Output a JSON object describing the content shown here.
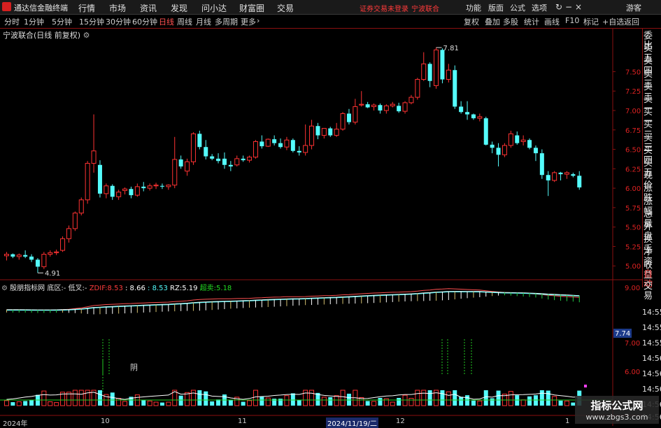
{
  "titlebar": {
    "app_name": "通达信金融终端",
    "menu": [
      "行情",
      "市场",
      "资讯",
      "发现",
      "问小达",
      "财富圈",
      "交易"
    ],
    "notice": "证券交易未登录",
    "stock_name": "宁波联合",
    "right_menu": [
      "功能",
      "版面",
      "公式",
      "选项"
    ],
    "user": "游客"
  },
  "period_bar": {
    "periods": [
      "分时",
      "1分钟",
      "5分钟",
      "15分钟",
      "30分钟",
      "60分钟",
      "日线",
      "周线",
      "月线",
      "多周期",
      "更多"
    ],
    "active": "日线",
    "tools": [
      "复权",
      "叠加",
      "多股",
      "统计",
      "画线",
      "F10",
      "标记",
      "+自选",
      "返回"
    ]
  },
  "price_panel": {
    "title": "宁波联合(日线 前复权)",
    "high_label": "7.81",
    "low_label": "4.91"
  },
  "side_panel": {
    "items": [
      "委比",
      "卖五",
      "卖四",
      "卖三",
      "卖二",
      "卖一",
      "买一",
      "买二",
      "买三",
      "买四",
      "买五",
      "现价",
      "涨跌",
      "涨幅",
      "总量",
      "外盘",
      "换手",
      "净资",
      "收益"
    ],
    "tabs": [
      "自动",
      "交易"
    ]
  },
  "indicator": {
    "name": "殷朋指标网",
    "zone_label": "底区:",
    "zone_value": "-",
    "low_label": "低叉:",
    "low_value": "-",
    "zdif_label": "ZDIF:",
    "zdif_value": "8.53",
    "v2": ": 8.66",
    "v3": ": 8.53",
    "rz_label": "RZ:",
    "rz_value": "5.19",
    "super_label": "超卖:",
    "super_value": "5.18",
    "current_tag": "7.74",
    "annotation": "阴"
  },
  "times": [
    "14:55",
    "14:55",
    "14:55",
    "14:56",
    "14:56",
    "14:56",
    "14:56",
    "14:56"
  ],
  "dates": [
    "2024年",
    "10",
    "11",
    "2024/11/19/二",
    "12",
    "1"
  ],
  "watermark": {
    "title": "指标公式网",
    "url": "www.zbgs3.com"
  },
  "colors": {
    "up": "#ff3232",
    "down": "#54fcfc",
    "grid": "#8a1010",
    "ma": "#ffffff"
  },
  "chart_data": {
    "type": "candlestick",
    "price_axis_ticks": [
      "7.50",
      "7.25",
      "7.00",
      "6.75",
      "6.50",
      "6.25",
      "6.00",
      "5.75",
      "5.50",
      "5.25",
      "5.00"
    ],
    "price_range": [
      4.84,
      7.9
    ],
    "indicator_axis_ticks": [
      "9.00",
      "7.00",
      "6.00"
    ],
    "candles": [
      [
        5.13,
        5.18,
        5.07,
        5.15
      ],
      [
        5.15,
        5.16,
        5.1,
        5.12
      ],
      [
        5.12,
        5.16,
        5.08,
        5.14
      ],
      [
        5.14,
        5.2,
        5.1,
        5.12
      ],
      [
        5.12,
        5.15,
        5.05,
        5.08
      ],
      [
        5.08,
        5.1,
        4.91,
        4.99
      ],
      [
        4.99,
        5.18,
        4.96,
        5.15
      ],
      [
        5.15,
        5.2,
        5.12,
        5.17
      ],
      [
        5.17,
        5.21,
        5.14,
        5.18
      ],
      [
        5.2,
        5.38,
        5.18,
        5.35
      ],
      [
        5.35,
        5.52,
        5.3,
        5.48
      ],
      [
        5.48,
        5.7,
        5.45,
        5.68
      ],
      [
        5.68,
        5.88,
        5.65,
        5.85
      ],
      [
        5.85,
        6.35,
        5.8,
        6.32
      ],
      [
        6.32,
        6.95,
        6.2,
        6.48
      ],
      [
        6.3,
        6.36,
        5.88,
        5.93
      ],
      [
        5.93,
        6.06,
        5.87,
        6.03
      ],
      [
        6.03,
        6.05,
        5.85,
        5.89
      ],
      [
        5.89,
        5.98,
        5.85,
        5.95
      ],
      [
        5.97,
        6.01,
        5.92,
        5.99
      ],
      [
        5.99,
        6.02,
        5.87,
        5.91
      ],
      [
        5.91,
        6.06,
        5.89,
        6.02
      ],
      [
        6.02,
        6.08,
        5.96,
        6.0
      ],
      [
        6.0,
        6.06,
        5.97,
        6.03
      ],
      [
        6.03,
        6.07,
        5.99,
        6.04
      ],
      [
        6.03,
        6.06,
        5.99,
        6.02
      ],
      [
        6.02,
        6.05,
        5.98,
        6.04
      ],
      [
        6.04,
        6.66,
        6.0,
        6.37
      ],
      [
        6.37,
        6.42,
        6.25,
        6.28
      ],
      [
        6.22,
        6.38,
        6.16,
        6.34
      ],
      [
        6.34,
        6.72,
        6.3,
        6.7
      ],
      [
        6.7,
        6.74,
        6.5,
        6.53
      ],
      [
        6.53,
        6.62,
        6.37,
        6.41
      ],
      [
        6.41,
        6.44,
        6.36,
        6.38
      ],
      [
        6.38,
        6.45,
        6.32,
        6.35
      ],
      [
        6.38,
        6.46,
        6.25,
        6.3
      ],
      [
        6.3,
        6.35,
        6.22,
        6.28
      ],
      [
        6.3,
        6.42,
        6.28,
        6.38
      ],
      [
        6.38,
        6.42,
        6.34,
        6.36
      ],
      [
        6.36,
        6.42,
        6.33,
        6.4
      ],
      [
        6.4,
        6.62,
        6.38,
        6.6
      ],
      [
        6.6,
        6.68,
        6.51,
        6.54
      ],
      [
        6.54,
        6.64,
        6.53,
        6.63
      ],
      [
        6.63,
        6.68,
        6.55,
        6.58
      ],
      [
        6.58,
        6.64,
        6.51,
        6.53
      ],
      [
        6.53,
        6.66,
        6.49,
        6.62
      ],
      [
        6.62,
        6.64,
        6.46,
        6.48
      ],
      [
        6.48,
        6.54,
        6.42,
        6.46
      ],
      [
        6.46,
        6.82,
        6.42,
        6.55
      ],
      [
        6.55,
        6.88,
        6.5,
        6.8
      ],
      [
        6.8,
        6.84,
        6.63,
        6.68
      ],
      [
        6.68,
        6.77,
        6.64,
        6.77
      ],
      [
        6.77,
        6.79,
        6.66,
        6.68
      ],
      [
        6.68,
        6.84,
        6.66,
        6.76
      ],
      [
        6.76,
        6.98,
        6.74,
        6.96
      ],
      [
        6.96,
        7.02,
        6.82,
        6.85
      ],
      [
        6.85,
        7.15,
        6.82,
        7.05
      ],
      [
        7.07,
        7.25,
        7.05,
        7.08
      ],
      [
        7.08,
        7.11,
        7.03,
        7.04
      ],
      [
        7.05,
        7.09,
        7.0,
        7.07
      ],
      [
        7.07,
        7.09,
        6.96,
        7.0
      ],
      [
        7.0,
        7.08,
        6.96,
        7.06
      ],
      [
        7.06,
        7.11,
        7.04,
        7.08
      ],
      [
        7.06,
        7.1,
        6.97,
        6.99
      ],
      [
        6.99,
        7.12,
        6.96,
        7.1
      ],
      [
        7.1,
        7.2,
        7.08,
        7.17
      ],
      [
        7.17,
        7.42,
        7.14,
        7.4
      ],
      [
        7.4,
        7.75,
        7.38,
        7.6
      ],
      [
        7.6,
        7.62,
        7.3,
        7.38
      ],
      [
        7.32,
        7.81,
        7.28,
        7.78
      ],
      [
        7.78,
        7.8,
        7.35,
        7.4
      ],
      [
        7.4,
        7.6,
        7.36,
        7.52
      ],
      [
        7.52,
        7.58,
        7.02,
        7.05
      ],
      [
        7.05,
        7.12,
        6.96,
        6.98
      ],
      [
        6.98,
        7.12,
        6.88,
        6.95
      ],
      [
        6.95,
        6.96,
        6.88,
        6.9
      ],
      [
        6.9,
        6.96,
        6.86,
        6.92
      ],
      [
        6.9,
        6.92,
        6.55,
        6.56
      ],
      [
        6.56,
        6.6,
        6.45,
        6.52
      ],
      [
        6.52,
        6.58,
        6.28,
        6.43
      ],
      [
        6.43,
        6.58,
        6.4,
        6.55
      ],
      [
        6.55,
        6.74,
        6.52,
        6.7
      ],
      [
        6.68,
        6.73,
        6.56,
        6.58
      ],
      [
        6.6,
        6.68,
        6.55,
        6.62
      ],
      [
        6.62,
        6.64,
        6.5,
        6.52
      ],
      [
        6.52,
        6.55,
        6.35,
        6.45
      ],
      [
        6.45,
        6.5,
        6.12,
        6.17
      ],
      [
        6.17,
        6.22,
        5.9,
        6.1
      ],
      [
        6.1,
        6.22,
        6.08,
        6.2
      ],
      [
        6.2,
        6.21,
        6.1,
        6.18
      ],
      [
        6.18,
        6.22,
        6.12,
        6.2
      ],
      [
        6.18,
        6.2,
        6.14,
        6.16
      ],
      [
        6.16,
        6.22,
        5.98,
        6.01
      ]
    ]
  }
}
